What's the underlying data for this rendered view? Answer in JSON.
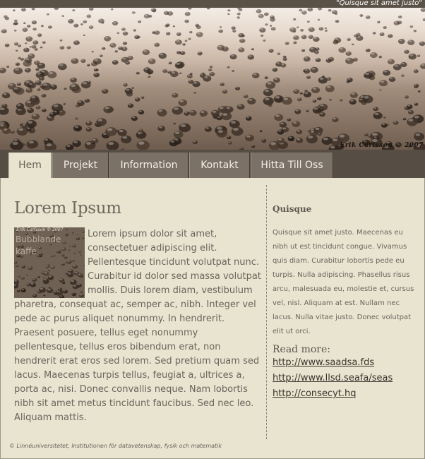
{
  "topbar": {
    "tagline": "\"Quisque sit amet justo\""
  },
  "banner": {
    "credit": "Erik Carlsson © 2007"
  },
  "nav": {
    "tabs": [
      {
        "label": "Hem"
      },
      {
        "label": "Projekt"
      },
      {
        "label": "Information"
      },
      {
        "label": "Kontakt"
      },
      {
        "label": "Hitta Till Oss"
      }
    ]
  },
  "main": {
    "title": "Lorem Ipsum",
    "thumb_credit": "Erik Carlsson © 2007",
    "thumb_alt": "Bubblande kaffe",
    "body": "Lorem ipsum dolor sit amet, consectetuer adipiscing elit. Pellentesque tincidunt volutpat nunc. Curabitur id dolor sed massa volutpat mollis. Duis lorem diam, vestibulum pharetra, consequat ac, semper ac, nibh. Integer vel pede ac purus aliquet nonummy. In hendrerit. Praesent posuere, tellus eget nonummy pellentesque, tellus eros bibendum erat, non hendrerit erat eros sed lorem. Sed pretium quam sed lacus. Maecenas turpis tellus, feugiat a, ultrices a, porta ac, nisi. Donec convallis neque. Nam lobortis nibh sit amet metus tincidunt faucibus. Sed nec leo. Aliquam mattis."
  },
  "sidebar": {
    "title": "Quisque",
    "text": "Quisque sit amet justo. Maecenas eu nibh ut est tincidunt congue. Vivamus quis diam. Curabitur lobortis pede eu turpis. Nulla adipiscing. Phasellus risus arcu, malesuada eu, molestie et, cursus vel, nisl. Aliquam at est. Nullam nec lacus. Nulla vitae justo. Donec volutpat elit ut orci.",
    "read_more": "Read more:",
    "links": [
      {
        "text": "http://www.saadsa.fds"
      },
      {
        "text": "http://www.llsd.seafa/seas"
      },
      {
        "text": "http://consecyt.hq"
      }
    ]
  },
  "footer": {
    "text": "© Linnéuniversitetet, Institutionen för datavetenskap, fysik och matematik"
  }
}
